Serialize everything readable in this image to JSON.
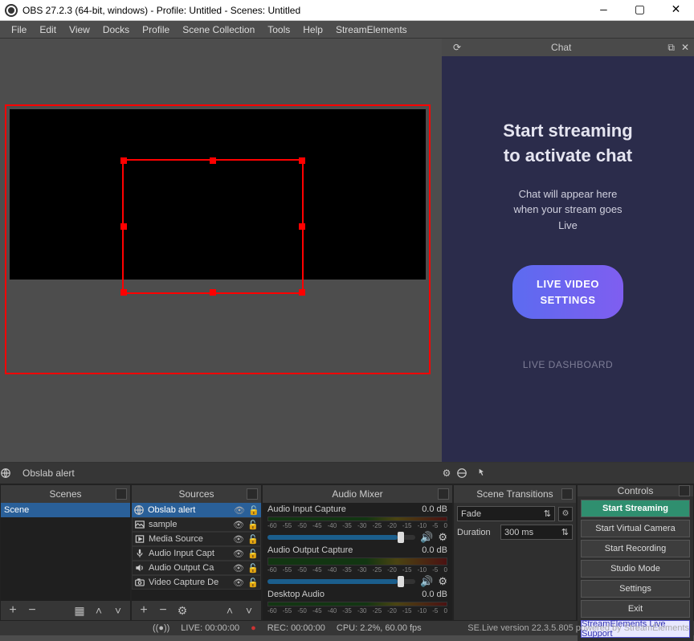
{
  "window": {
    "title": "OBS 27.2.3 (64-bit, windows) - Profile: Untitled - Scenes: Untitled"
  },
  "menu": [
    "File",
    "Edit",
    "View",
    "Docks",
    "Profile",
    "Scene Collection",
    "Tools",
    "Help",
    "StreamElements"
  ],
  "chat": {
    "title": "Chat",
    "headline1": "Start streaming",
    "headline2": "to activate chat",
    "sub1": "Chat will appear here",
    "sub2": "when your stream goes",
    "sub3": "Live",
    "btn1": "LIVE VIDEO",
    "btn2": "SETTINGS",
    "dash": "LIVE DASHBOARD"
  },
  "toolrow": {
    "label": "Obslab alert"
  },
  "panels": {
    "scenes": "Scenes",
    "sources": "Sources",
    "mixer": "Audio Mixer",
    "transitions": "Scene Transitions",
    "controls": "Controls"
  },
  "scenes": [
    "Scene"
  ],
  "sources": [
    {
      "icon": "globe",
      "label": "Obslab alert"
    },
    {
      "icon": "image",
      "label": "sample"
    },
    {
      "icon": "clip",
      "label": "Media Source"
    },
    {
      "icon": "mic",
      "label": "Audio Input Capt"
    },
    {
      "icon": "spk",
      "label": "Audio Output Ca"
    },
    {
      "icon": "cam",
      "label": "Video Capture De"
    }
  ],
  "mixer": [
    {
      "name": "Audio Input Capture",
      "db": "0.0 dB"
    },
    {
      "name": "Audio Output Capture",
      "db": "0.0 dB"
    },
    {
      "name": "Desktop Audio",
      "db": "0.0 dB"
    }
  ],
  "ticks": [
    "-60",
    "-55",
    "-50",
    "-45",
    "-40",
    "-35",
    "-30",
    "-25",
    "-20",
    "-15",
    "-10",
    "-5",
    "0"
  ],
  "transitions": {
    "type": "Fade",
    "duration_label": "Duration",
    "duration_value": "300 ms"
  },
  "controls": [
    "Start Streaming",
    "Start Virtual Camera",
    "Start Recording",
    "Studio Mode",
    "Settings",
    "Exit",
    "StreamElements Live Support"
  ],
  "status": {
    "left_pad": "",
    "live": "LIVE: 00:00:00",
    "rec": "REC: 00:00:00",
    "cpu": "CPU: 2.2%, 60.00 fps",
    "right": "SE.Live version 22.3.5.805 powered by StreamElements"
  }
}
